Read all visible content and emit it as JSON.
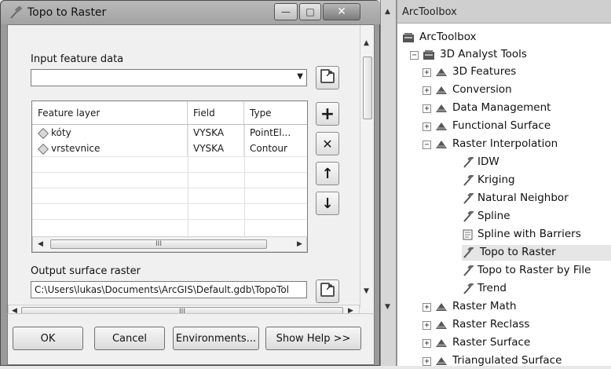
{
  "dialog": {
    "title": "Topo to Raster",
    "window_controls": {
      "minimize": "—",
      "maximize": "□",
      "close": "✕"
    },
    "input_label": "Input feature data",
    "input_value": "",
    "table": {
      "columns": [
        "Feature layer",
        "Field",
        "Type"
      ],
      "rows": [
        {
          "layer": "kóty",
          "field": "VYSKA",
          "type": "PointEl..."
        },
        {
          "layer": "vrstevnice",
          "field": "VYSKA",
          "type": "Contour"
        }
      ],
      "scroll_mark": "III"
    },
    "side_buttons": {
      "add": "+",
      "remove": "✕",
      "up": "↑",
      "down": "↓"
    },
    "output_label": "Output surface raster",
    "output_value": "C:\\Users\\lukas\\Documents\\ArcGIS\\Default.gdb\\TopoTol",
    "bottom_scroll_mark": "III",
    "buttons": {
      "ok": "OK",
      "cancel": "Cancel",
      "environments": "Environments...",
      "help": "Show Help >>"
    }
  },
  "toolbox": {
    "header": "ArcToolbox",
    "root": "ArcToolbox",
    "analyst": "3D Analyst Tools",
    "items": [
      {
        "label": "3D Features",
        "kind": "toolset",
        "expander": "+"
      },
      {
        "label": "Conversion",
        "kind": "toolset",
        "expander": "+"
      },
      {
        "label": "Data Management",
        "kind": "toolset",
        "expander": "+"
      },
      {
        "label": "Functional Surface",
        "kind": "toolset",
        "expander": "+"
      },
      {
        "label": "Raster Interpolation",
        "kind": "toolset",
        "expander": "−"
      },
      {
        "label": "IDW",
        "kind": "tool"
      },
      {
        "label": "Kriging",
        "kind": "tool"
      },
      {
        "label": "Natural Neighbor",
        "kind": "tool"
      },
      {
        "label": "Spline",
        "kind": "tool"
      },
      {
        "label": "Spline with Barriers",
        "kind": "script"
      },
      {
        "label": "Topo to Raster",
        "kind": "tool",
        "selected": true
      },
      {
        "label": "Topo to Raster by File",
        "kind": "tool"
      },
      {
        "label": "Trend",
        "kind": "tool"
      },
      {
        "label": "Raster Math",
        "kind": "toolset",
        "expander": "+"
      },
      {
        "label": "Raster Reclass",
        "kind": "toolset",
        "expander": "+"
      },
      {
        "label": "Raster Surface",
        "kind": "toolset",
        "expander": "+"
      },
      {
        "label": "Triangulated Surface",
        "kind": "toolset",
        "expander": "+"
      }
    ]
  }
}
